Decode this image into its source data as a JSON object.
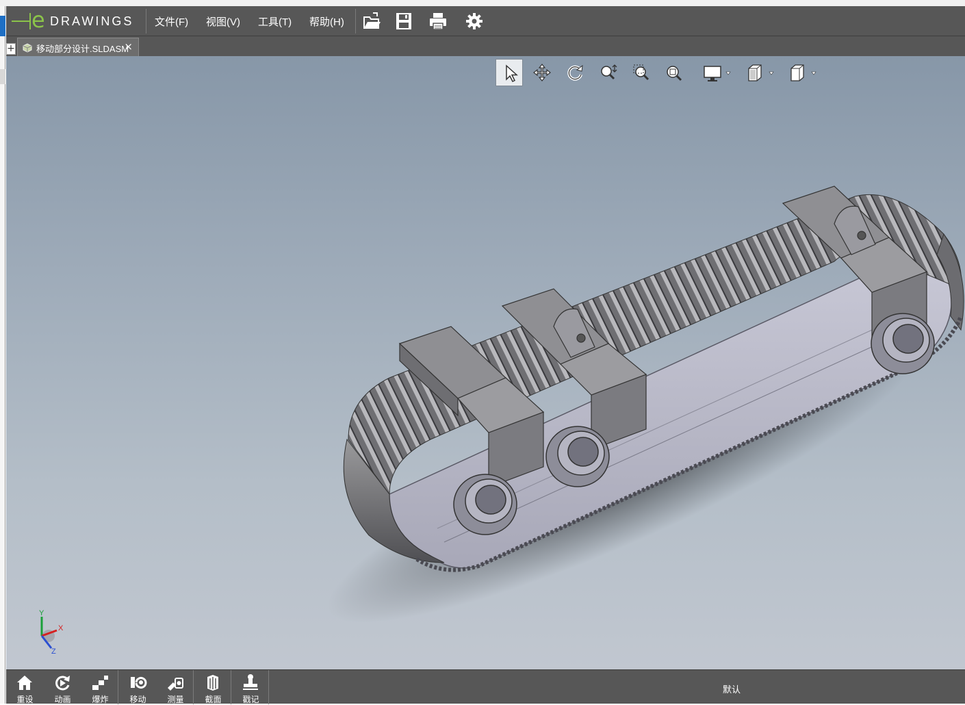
{
  "app": {
    "logo_text": "DRAWINGS",
    "logo_letter": "e",
    "accent_color": "#8bc34a"
  },
  "menu": {
    "file": "文件(F)",
    "view": "视图(V)",
    "tools": "工具(T)",
    "help": "帮助(H)"
  },
  "toolbar": {
    "icons": [
      "open-icon",
      "save-icon",
      "print-icon",
      "settings-icon"
    ]
  },
  "tab": {
    "plus": "+",
    "filename": "移动部分设计.SLDASM",
    "close": "×"
  },
  "view_toolbar": {
    "icons": [
      "select-icon",
      "pan-icon",
      "rotate-icon",
      "zoom-icon",
      "zoom-to-area-icon",
      "zoom-to-fit-icon",
      "display-icon",
      "shading-icon",
      "standard-views-icon"
    ]
  },
  "triad": {
    "x": "X",
    "y": "Y",
    "z": "Z"
  },
  "bottom_tools": [
    {
      "label": "重设",
      "icon": "home-icon"
    },
    {
      "label": "动画",
      "icon": "animate-icon"
    },
    {
      "label": "爆炸",
      "icon": "explode-icon"
    },
    {
      "label": "移动",
      "icon": "move-icon"
    },
    {
      "label": "测量",
      "icon": "measure-icon"
    },
    {
      "label": "截面",
      "icon": "section-icon"
    },
    {
      "label": "戳记",
      "icon": "stamp-icon"
    }
  ],
  "status": {
    "configuration": "默认"
  }
}
